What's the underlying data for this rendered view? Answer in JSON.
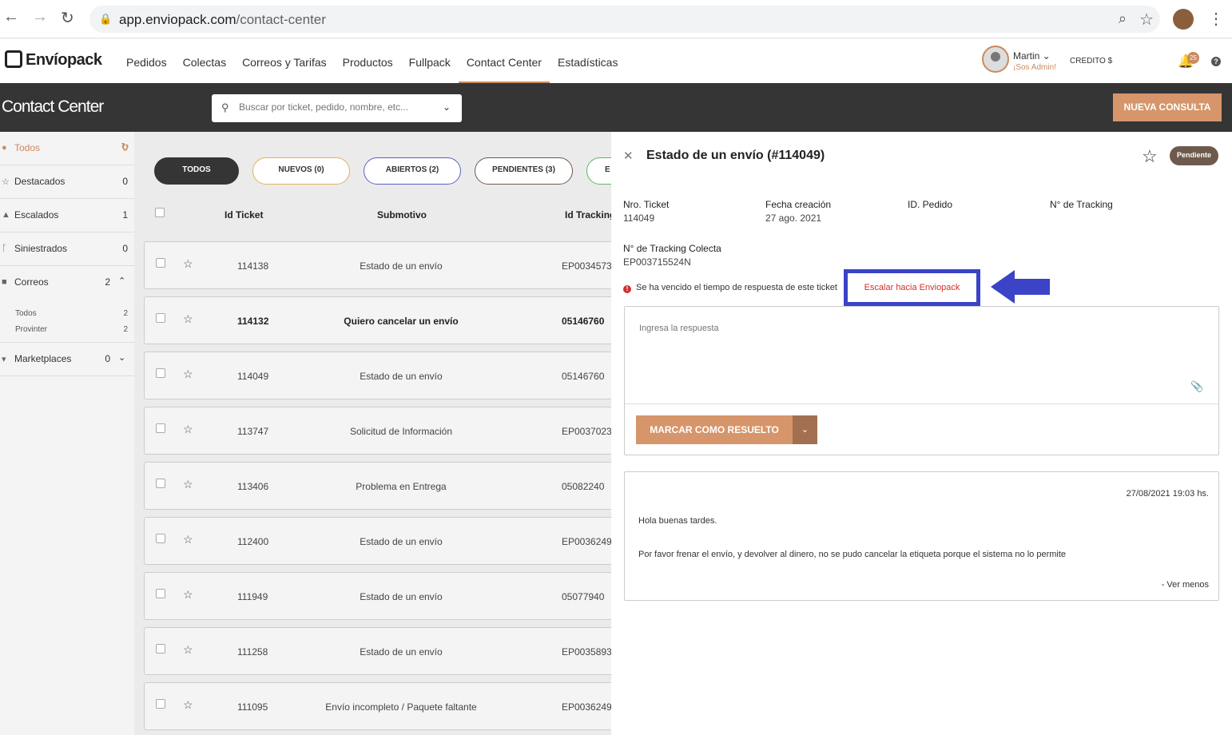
{
  "browser": {
    "url_host": "app.enviopack.com",
    "url_path": "/contact-center"
  },
  "app": {
    "logo": "Envíopack",
    "menu": [
      "Pedidos",
      "Colectas",
      "Correos y Tarifas",
      "Productos",
      "Fullpack",
      "Contact Center",
      "Estadísticas"
    ],
    "active_menu": "Contact Center",
    "user_name": "Martin ⌄",
    "user_role": "¡Sos Admin!",
    "credit_label": "CREDITO $",
    "notifications": "25"
  },
  "toolbar": {
    "title": "Contact Center",
    "search_placeholder": "Buscar por ticket, pedido, nombre, etc...",
    "new_button": "NUEVA CONSULTA"
  },
  "sidebar": {
    "items": [
      {
        "label": "Todos",
        "count": "0",
        "icon": "chat-icon"
      },
      {
        "label": "Destacados",
        "count": "0",
        "icon": "star-icon"
      },
      {
        "label": "Escalados",
        "count": "1",
        "icon": "warning-icon"
      },
      {
        "label": "Siniestrados",
        "count": "0",
        "icon": "flag-icon"
      },
      {
        "label": "Correos",
        "count": "2",
        "icon": "truck-icon"
      },
      {
        "label": "Marketplaces",
        "count": "0",
        "icon": "cart-icon"
      }
    ],
    "correos_sub": [
      {
        "label": "Todos",
        "count": "2"
      },
      {
        "label": "Provinter",
        "count": "2"
      }
    ]
  },
  "filters": [
    {
      "label": "TODOS",
      "color": "#353535"
    },
    {
      "label": "NUEVOS (0)",
      "color": "#e0b060"
    },
    {
      "label": "ABIERTOS (2)",
      "color": "#5b5fc7"
    },
    {
      "label": "PENDIENTES (3)",
      "color": "#6e5a4c"
    },
    {
      "label": "E",
      "color": "#5cb85c"
    }
  ],
  "table": {
    "headers": [
      "Id Ticket",
      "Submotivo",
      "Id Tracking"
    ],
    "rows": [
      {
        "id": "114138",
        "sub": "Estado de un envío",
        "track": "EP0034573",
        "bold": false
      },
      {
        "id": "114132",
        "sub": "Quiero cancelar un envío",
        "track": "05146760",
        "bold": true
      },
      {
        "id": "114049",
        "sub": "Estado de un envío",
        "track": "05146760",
        "bold": false
      },
      {
        "id": "113747",
        "sub": "Solicitud de Información",
        "track": "EP0037023",
        "bold": false
      },
      {
        "id": "113406",
        "sub": "Problema en Entrega",
        "track": "05082240",
        "bold": false
      },
      {
        "id": "112400",
        "sub": "Estado de un envío",
        "track": "EP0036249",
        "bold": false
      },
      {
        "id": "111949",
        "sub": "Estado de un envío",
        "track": "05077940",
        "bold": false
      },
      {
        "id": "111258",
        "sub": "Estado de un envío",
        "track": "EP0035893",
        "bold": false
      },
      {
        "id": "111095",
        "sub": "Envío incompleto / Paquete faltante",
        "track": "EP0036249",
        "bold": false
      }
    ]
  },
  "detail": {
    "title": "Estado de un envío (#114049)",
    "status": "Pendiente",
    "fields": {
      "ticket_label": "Nro. Ticket",
      "ticket_value": "114049",
      "fecha_label": "Fecha creación",
      "fecha_value": "27 ago. 2021",
      "pedido_label": "ID. Pedido",
      "tracking_label": "N° de Tracking",
      "colecta_label": "N° de Tracking Colecta",
      "colecta_value": "EP003715524N"
    },
    "warning": "Se ha vencido el tiempo de respuesta de este ticket",
    "escalar": "Escalar hacia Enviopack",
    "reply_placeholder": "Ingresa la respuesta",
    "resolve_button": "MARCAR COMO RESUELTO",
    "message": {
      "date": "27/08/2021 19:03 hs.",
      "line1": "Hola buenas tardes.",
      "line2": "Por favor frenar el envío, y devolver al dinero, no se pudo cancelar la etiqueta porque el sistema no lo permite",
      "toggle": "- Ver menos"
    }
  }
}
